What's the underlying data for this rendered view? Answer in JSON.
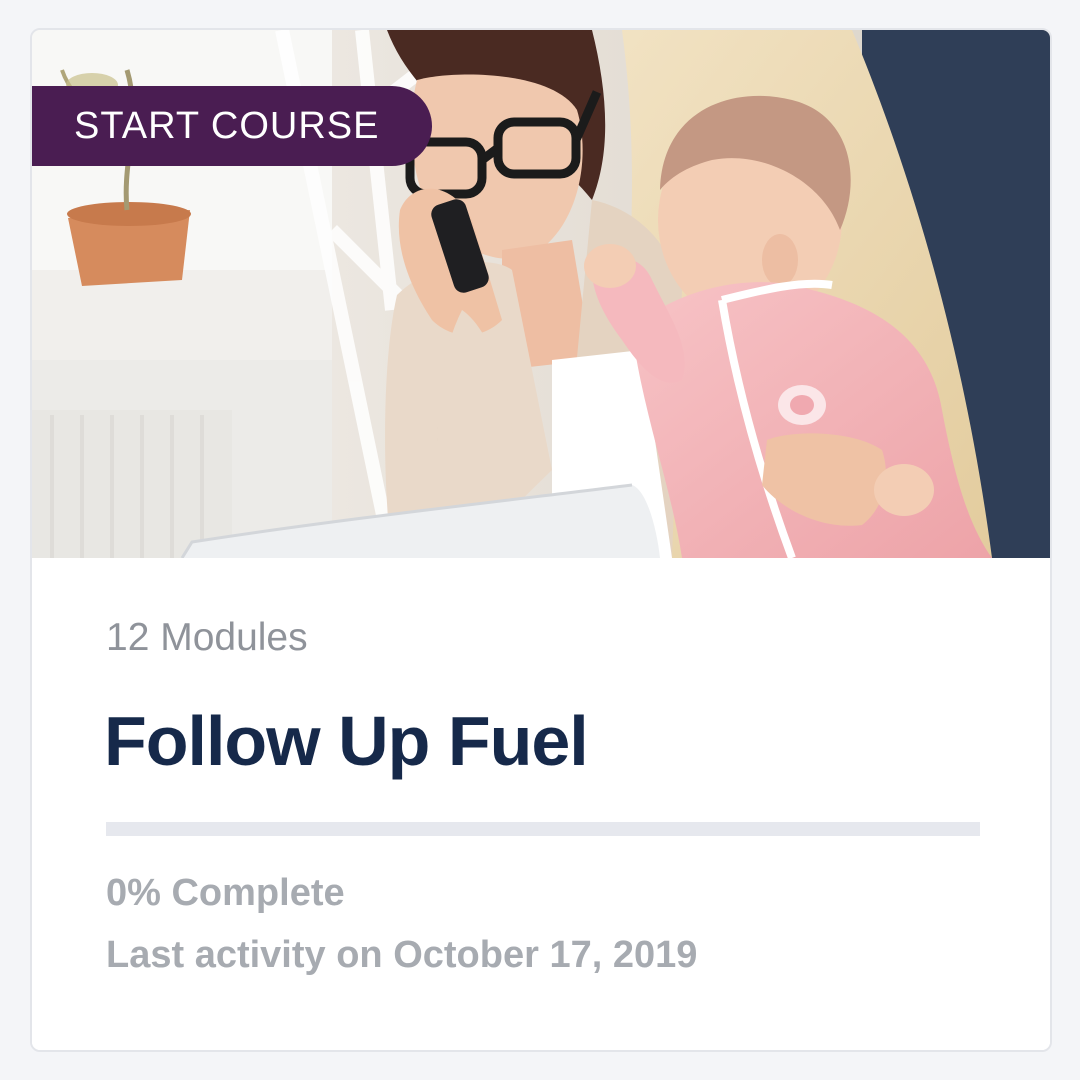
{
  "course_card": {
    "badge_label": "START COURSE",
    "modules_count": "12 Modules",
    "title": "Follow Up Fuel",
    "progress_percent": 0,
    "progress_text": "0% Complete",
    "last_activity": "Last activity on October 17, 2019",
    "image_subject": "woman-on-phone-holding-baby-photo",
    "colors": {
      "badge_bg": "#4a1d52",
      "title": "#16294a",
      "muted_text": "#a7abb1",
      "progress_track": "#e6e8ee"
    }
  }
}
